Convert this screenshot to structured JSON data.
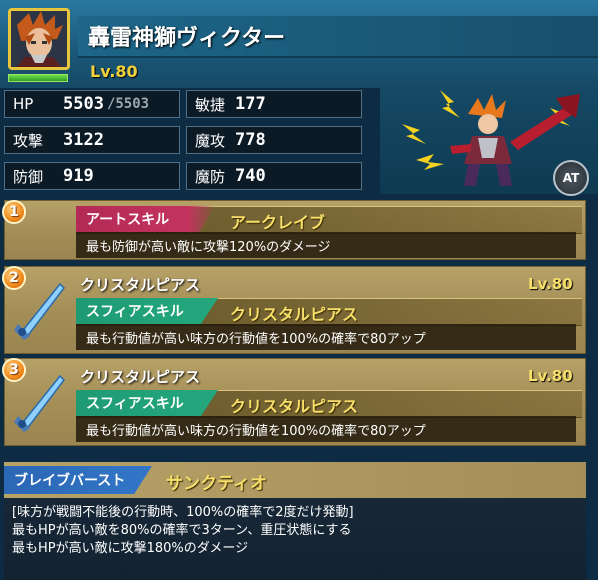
{
  "unit": {
    "name": "轟雷神獅ヴィクター",
    "level": "Lv.80",
    "hp_fraction": 1.0
  },
  "stats": {
    "hp_label": "HP",
    "hp_value": "5503",
    "hp_max": "/5503",
    "agility_label": "敏捷",
    "agility_value": "177",
    "attack_label": "攻撃",
    "attack_value": "3122",
    "magic_attack_label": "魔攻",
    "magic_attack_value": "778",
    "defense_label": "防御",
    "defense_value": "919",
    "magic_defense_label": "魔防",
    "magic_defense_value": "740"
  },
  "at_badge": "AT",
  "skills": [
    {
      "number": "1",
      "type": "アートスキル",
      "name": "アークレイブ",
      "description": "最も防御が高い敵に攻撃120%のダメージ"
    },
    {
      "number": "2",
      "sphere_title": "クリスタルピアス",
      "sphere_level": "Lv.80",
      "type": "スフィアスキル",
      "name": "クリスタルピアス",
      "description": "最も行動値が高い味方の行動値を100%の確率で80アップ"
    },
    {
      "number": "3",
      "sphere_title": "クリスタルピアス",
      "sphere_level": "Lv.80",
      "type": "スフィアスキル",
      "name": "クリスタルピアス",
      "description": "最も行動値が高い味方の行動値を100%の確率で80アップ"
    }
  ],
  "brave_burst": {
    "label": "ブレイブバースト",
    "name": "サンクティオ",
    "lines": [
      "[味方が戦闘不能後の行動時、100%の確率で2度だけ発動]",
      "最もHPが高い敵を80%の確率で3ターン、重圧状態にする",
      "最もHPが高い敵に攻撃180%のダメージ"
    ]
  },
  "colors": {
    "header": "#1a5778",
    "gold_text": "#f6df6a",
    "art_tag": "#b22a56",
    "sphere_tag": "#1f9a73",
    "bb_tag": "#2b67b5"
  }
}
